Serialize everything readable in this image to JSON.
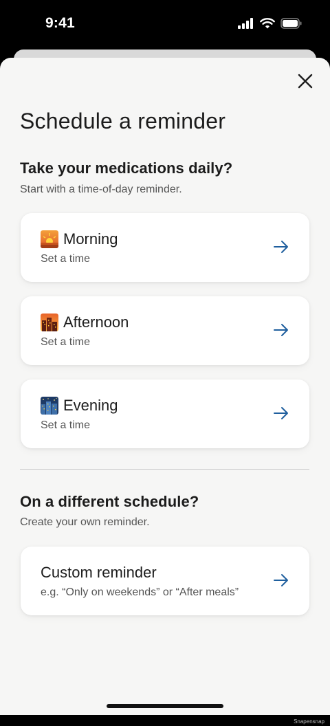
{
  "status_bar": {
    "time": "9:41"
  },
  "title": "Schedule a reminder",
  "daily": {
    "heading": "Take your medications daily?",
    "subheading": "Start with a time-of-day reminder.",
    "options": [
      {
        "label": "Morning",
        "sub": "Set a time",
        "icon": "sunrise-icon"
      },
      {
        "label": "Afternoon",
        "sub": "Set a time",
        "icon": "city-sunset-icon"
      },
      {
        "label": "Evening",
        "sub": "Set a time",
        "icon": "night-city-icon"
      }
    ]
  },
  "custom": {
    "heading": "On a different schedule?",
    "subheading": "Create your own reminder.",
    "option": {
      "label": "Custom reminder",
      "sub": "e.g. “Only on weekends” or “After meals”"
    }
  },
  "watermark": "Snapensnap",
  "colors": {
    "accent": "#1f5f9e",
    "sheet_bg": "#f6f6f5",
    "card_bg": "#ffffff",
    "text_primary": "#1c1c1c",
    "text_secondary": "#555555"
  }
}
